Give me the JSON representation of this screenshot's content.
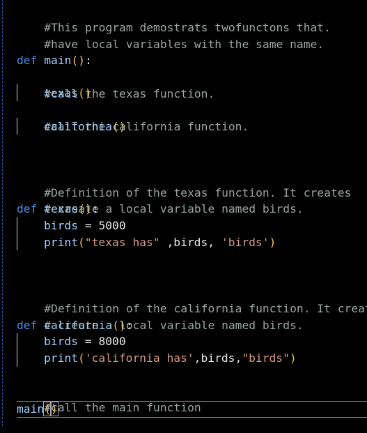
{
  "editor": {
    "lines": [
      {
        "id": "l1",
        "text": "#This program demostrats twofunctons that."
      },
      {
        "id": "l2",
        "text": "#have local variables with the same name."
      },
      {
        "id": "l4",
        "kw": "def",
        "name": "main",
        "open": "(",
        "close": ")",
        "colon": ":"
      },
      {
        "id": "l5",
        "text": "#call the texas function."
      },
      {
        "id": "l6",
        "name": "texas",
        "open": "(",
        "close": ")"
      },
      {
        "id": "l7",
        "text": "#call the california function."
      },
      {
        "id": "l8",
        "name": "california",
        "open": "(",
        "close": ")"
      },
      {
        "id": "l11",
        "text": "#Definition of the texas function. It creates"
      },
      {
        "id": "l12",
        "text": "# create a local variable named birds."
      },
      {
        "id": "l13",
        "kw": "def",
        "name": "texas",
        "open": "(",
        "close": ")",
        "colon": ":"
      },
      {
        "id": "l14",
        "var": "birds",
        "op": " = ",
        "value": "5000"
      },
      {
        "id": "l15",
        "name": "print",
        "open": "(",
        "str1": "\"texas has\"",
        "mid": " ,birds, ",
        "str2": "'birds'",
        "close": ")"
      },
      {
        "id": "l18",
        "text": "#Definition of the california function. It creates"
      },
      {
        "id": "l19",
        "text": "# create a local variable named birds."
      },
      {
        "id": "l20",
        "kw": "def",
        "name": "california",
        "open": "(",
        "close": ")",
        "colon": ":"
      },
      {
        "id": "l21",
        "var": "birds",
        "op": " = ",
        "value": "8000"
      },
      {
        "id": "l22",
        "name": "print",
        "open": "(",
        "str1": "'california has'",
        "mid": ",birds,",
        "str2": "\"birds\"",
        "close": ")"
      },
      {
        "id": "l24",
        "text": "#call the main function"
      },
      {
        "id": "l25",
        "name": "main",
        "open": "(",
        "close": ")"
      }
    ]
  }
}
